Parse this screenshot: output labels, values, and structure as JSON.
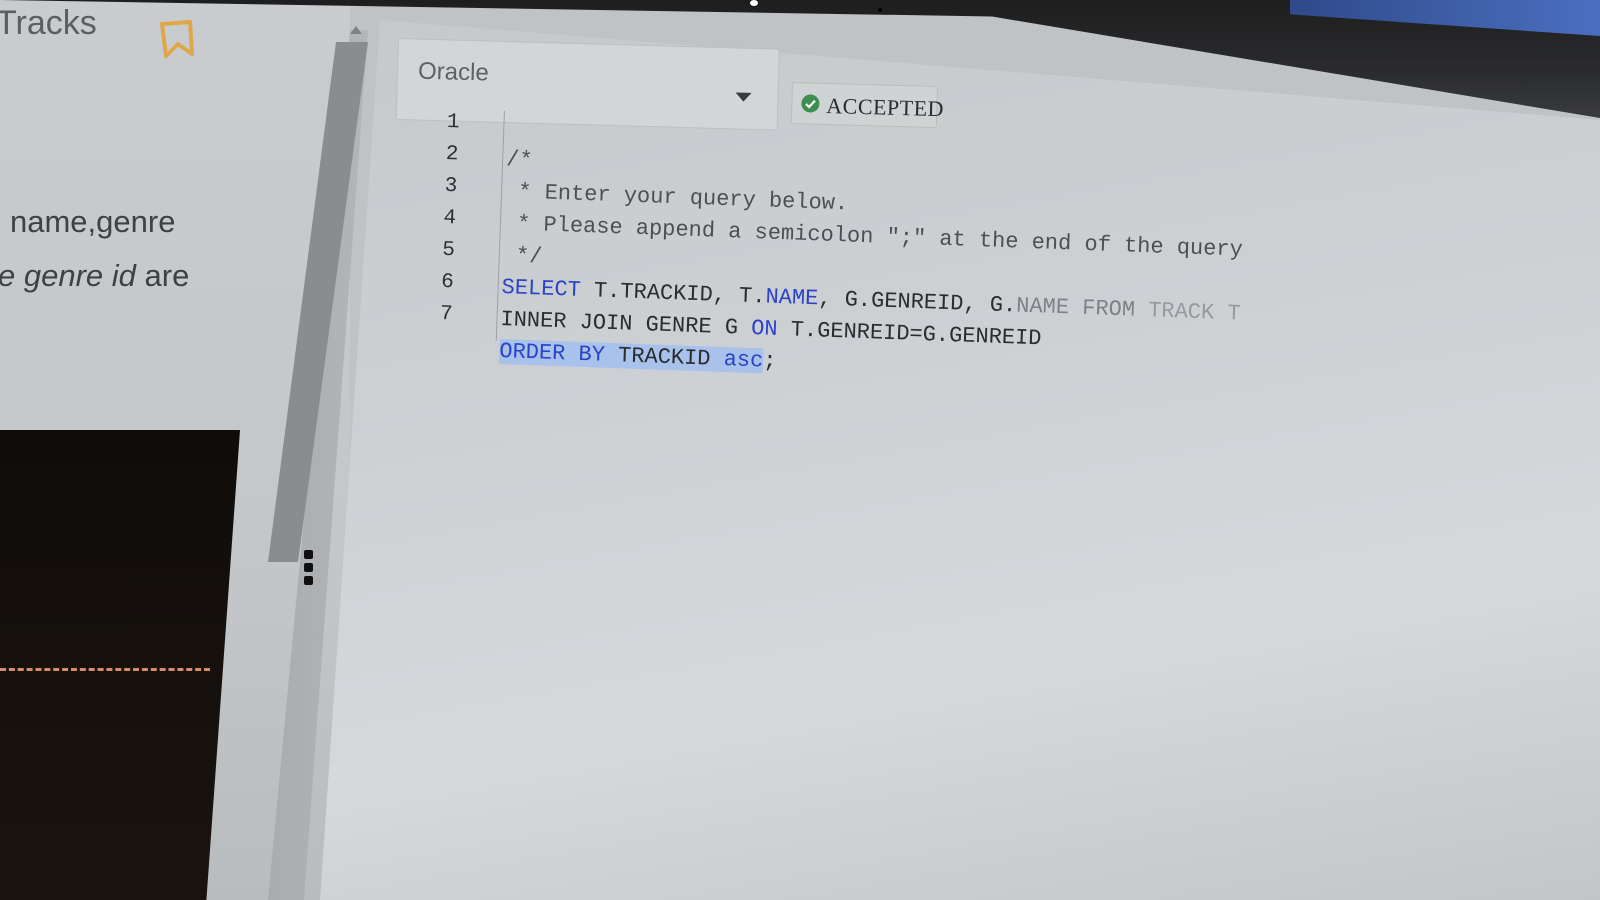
{
  "problem": {
    "title": "Tracks",
    "description_line1": "name,genre",
    "description_line2_prefix": "e genre id",
    "description_line2_suffix": "are"
  },
  "editor": {
    "language_selected": "Oracle",
    "status_badge": "ACCEPTED",
    "lines": [
      {
        "num": "1",
        "text": "/*"
      },
      {
        "num": "2",
        "text": " * Enter your query below."
      },
      {
        "num": "3",
        "text": " * Please append a semicolon \";\" at the end of the query"
      },
      {
        "num": "4",
        "text": " */"
      },
      {
        "num": "5",
        "kw1": "SELECT",
        "rest1": " T.TRACKID, T.",
        "kw2": "NAME",
        "rest2": ", G.GENREID, G.",
        "kw3": "NAME",
        "sp": " ",
        "kw4": "FROM",
        "rest3": " TRACK T"
      },
      {
        "num": "6",
        "plain1": "INNER JOIN GENRE G ",
        "kw1": "ON",
        "plain2": " T.GENREID=G.GENREID"
      },
      {
        "num": "7",
        "kw1": "ORDER BY",
        "plain1": " TRACKID ",
        "kw2": "asc",
        "plain2": ";"
      }
    ]
  },
  "colors": {
    "keyword": "#2a43c9",
    "selection": "#a9c2ec",
    "accent_bookmark": "#e0a64a",
    "accepted_green": "#3c8f4f"
  },
  "icons": {
    "bookmark": "bookmark-icon",
    "dropdown": "chevron-down-icon",
    "accepted": "check-circle-icon",
    "resize": "drag-handle-icon"
  }
}
